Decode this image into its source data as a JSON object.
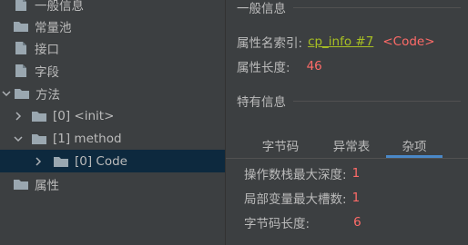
{
  "tree": {
    "items": [
      {
        "label": "一般信息",
        "icon": "file-icon"
      },
      {
        "label": "常量池",
        "icon": "folder-icon"
      },
      {
        "label": "接口",
        "icon": "file-icon"
      },
      {
        "label": "字段",
        "icon": "file-icon"
      },
      {
        "label": "方法",
        "icon": "folder-icon",
        "expanded": true
      },
      {
        "label": "[0] <init>",
        "icon": "folder-icon",
        "expanded": false
      },
      {
        "label": "[1] method",
        "icon": "folder-icon",
        "expanded": true
      },
      {
        "label": "[0] Code",
        "icon": "folder-icon",
        "expanded": false,
        "selected": true
      },
      {
        "label": "属性",
        "icon": "folder-icon"
      }
    ]
  },
  "details": {
    "general_header": "一般信息",
    "name_index_label": "属性名索引:",
    "name_index_link": "cp_info #7",
    "name_index_tag": "<Code>",
    "length_label": "属性长度:",
    "length_value": "46",
    "specific_header": "特有信息",
    "tabs": [
      "字节码",
      "异常表",
      "杂项"
    ],
    "active_tab": "杂项",
    "stats": [
      {
        "label": "操作数栈最大深度:",
        "value": "1"
      },
      {
        "label": "局部变量最大槽数:",
        "value": "1"
      },
      {
        "label": "字节码长度:",
        "value": "6"
      }
    ]
  },
  "colors": {
    "background": "#3c3f41",
    "selection": "#0d293e",
    "value_red": "#ff6b68",
    "link_green": "#a8c023",
    "tab_accent": "#4a88c7"
  }
}
